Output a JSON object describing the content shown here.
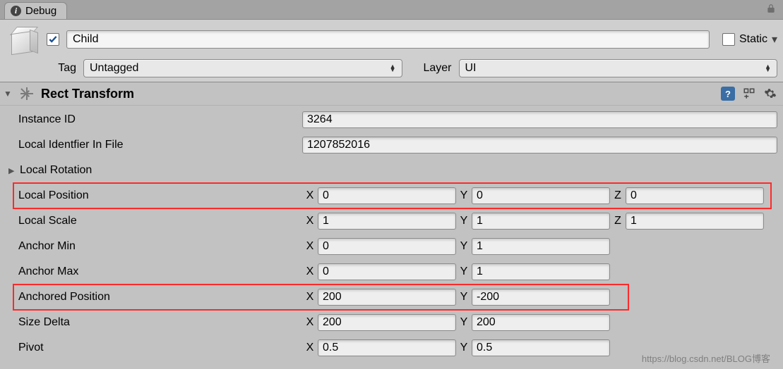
{
  "tab": {
    "title": "Debug"
  },
  "header": {
    "enabled": true,
    "name": "Child",
    "static_label": "Static",
    "static_checked": false,
    "tag_label": "Tag",
    "tag_value": "Untagged",
    "layer_label": "Layer",
    "layer_value": "UI"
  },
  "component": {
    "title": "Rect Transform"
  },
  "props": {
    "instance_id": {
      "label": "Instance ID",
      "value": "3264"
    },
    "local_identifier": {
      "label": "Local Identfier In File",
      "value": "1207852016"
    },
    "local_rotation": {
      "label": "Local Rotation"
    },
    "local_position": {
      "label": "Local Position",
      "x": "0",
      "y": "0",
      "z": "0"
    },
    "local_scale": {
      "label": "Local Scale",
      "x": "1",
      "y": "1",
      "z": "1"
    },
    "anchor_min": {
      "label": "Anchor Min",
      "x": "0",
      "y": "1"
    },
    "anchor_max": {
      "label": "Anchor Max",
      "x": "0",
      "y": "1"
    },
    "anchored_pos": {
      "label": "Anchored Position",
      "x": "200",
      "y": "-200"
    },
    "size_delta": {
      "label": "Size Delta",
      "x": "200",
      "y": "200"
    },
    "pivot": {
      "label": "Pivot",
      "x": "0.5",
      "y": "0.5"
    }
  },
  "axis": {
    "x": "X",
    "y": "Y",
    "z": "Z"
  },
  "watermark": "https://blog.csdn.net/BLOG博客"
}
